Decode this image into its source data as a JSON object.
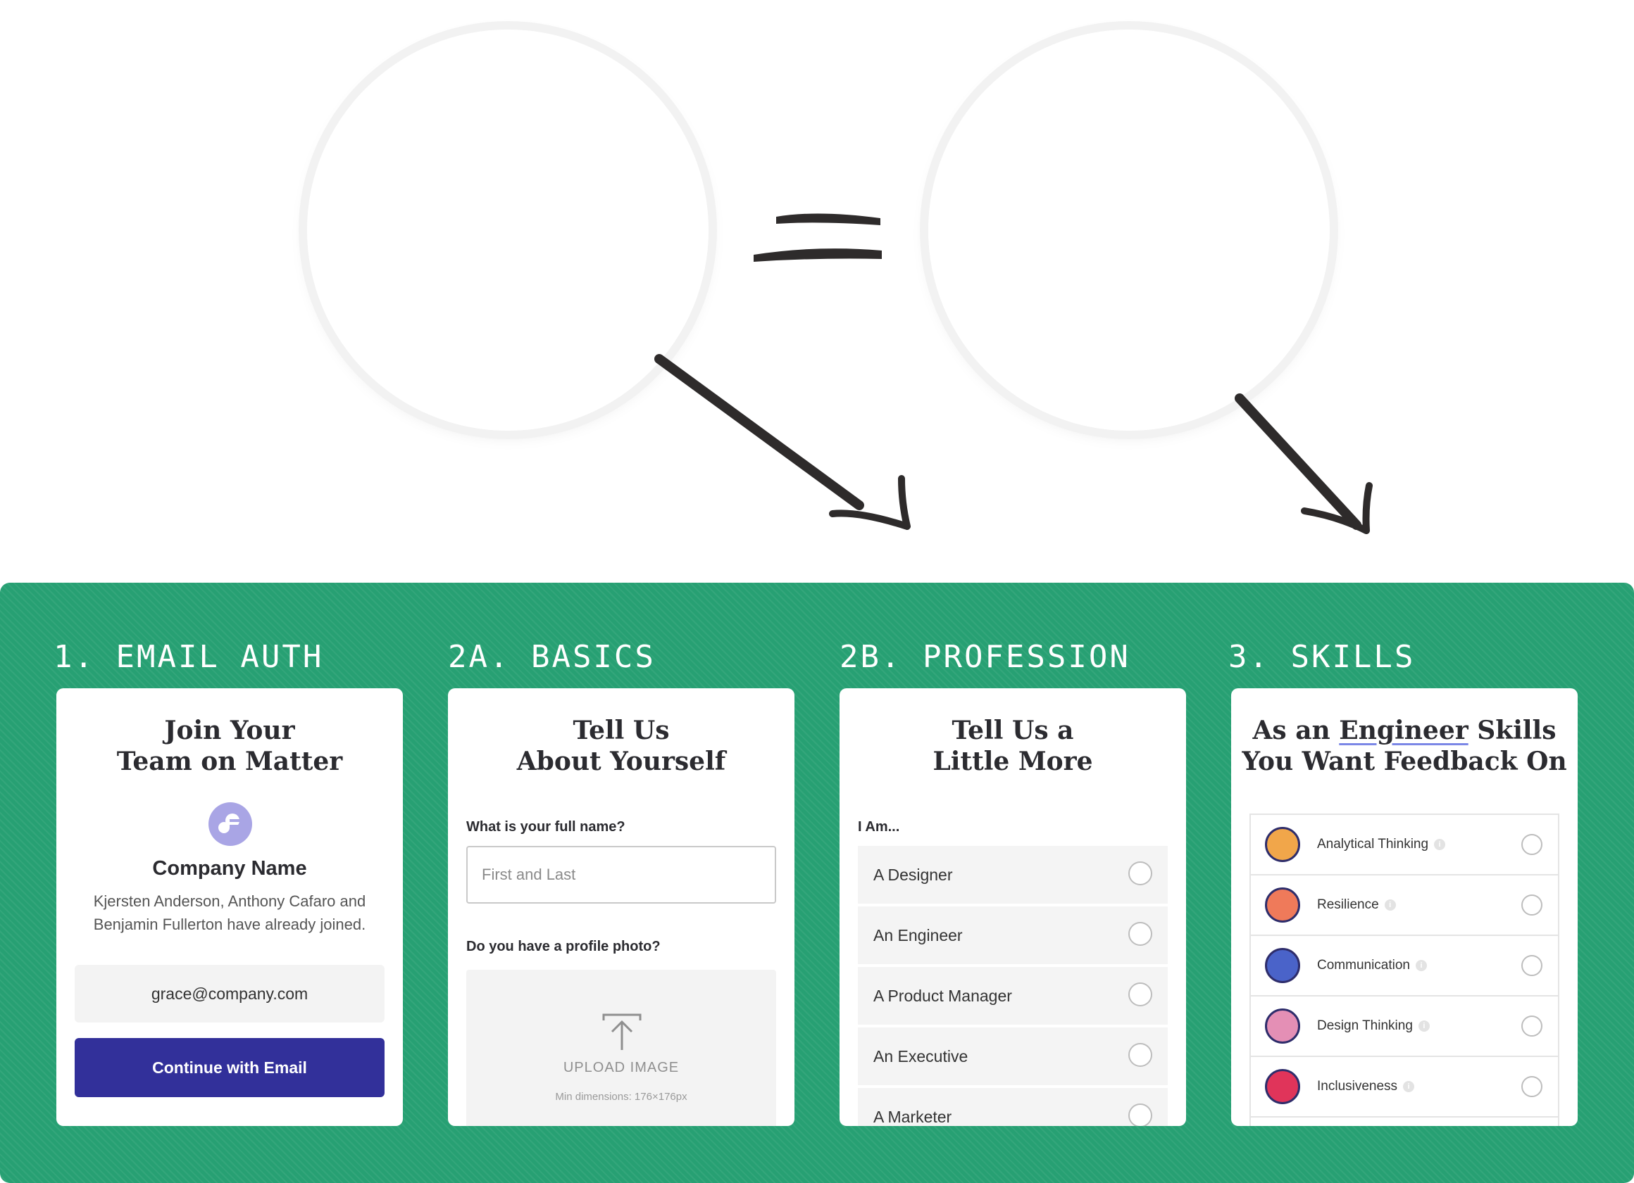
{
  "steps": [
    {
      "label": "1. EMAIL AUTH"
    },
    {
      "label": "2A. BASICS"
    },
    {
      "label": "2B. PROFESSION"
    },
    {
      "label": "3. SKILLS"
    }
  ],
  "email_auth": {
    "title_line1": "Join Your",
    "title_line2": "Team on Matter",
    "company_name": "Company Name",
    "joined_line1": "Kjersten Anderson, Anthony Cafaro and",
    "joined_line2": "Benjamin Fullerton have already joined.",
    "email_value": "grace@company.com",
    "continue_label": "Continue with Email"
  },
  "basics": {
    "title_line1": "Tell Us",
    "title_line2": "About Yourself",
    "name_question": "What is your full name?",
    "name_placeholder": "First and Last",
    "photo_question": "Do you have a profile photo?",
    "upload_label": "UPLOAD IMAGE",
    "upload_hint": "Min dimensions: 176×176px"
  },
  "profession": {
    "title_line1": "Tell Us a",
    "title_line2": "Little More",
    "iam_label": "I Am...",
    "options": [
      "A Designer",
      "An Engineer",
      "A Product Manager",
      "An Executive",
      "A Marketer"
    ]
  },
  "skills": {
    "title_prefix": "As an",
    "title_role": "Engineer",
    "title_suffix": "Skills",
    "title_line2": "You Want Feedback On",
    "items": [
      {
        "label": "Analytical Thinking",
        "icon": "magnifier-puzzle-icon",
        "color": "#f1a64a"
      },
      {
        "label": "Resilience",
        "icon": "flower-icon",
        "color": "#ef7a5a"
      },
      {
        "label": "Communication",
        "icon": "speech-bubbles-icon",
        "color": "#4a63c9"
      },
      {
        "label": "Design Thinking",
        "icon": "cube-icon",
        "color": "#e48fb5"
      },
      {
        "label": "Inclusiveness",
        "icon": "infinity-heart-icon",
        "color": "#e0345a"
      }
    ]
  },
  "colors": {
    "panel_green": "#27a073",
    "cta_blue": "#32309a",
    "underline": "#7b87e6"
  }
}
